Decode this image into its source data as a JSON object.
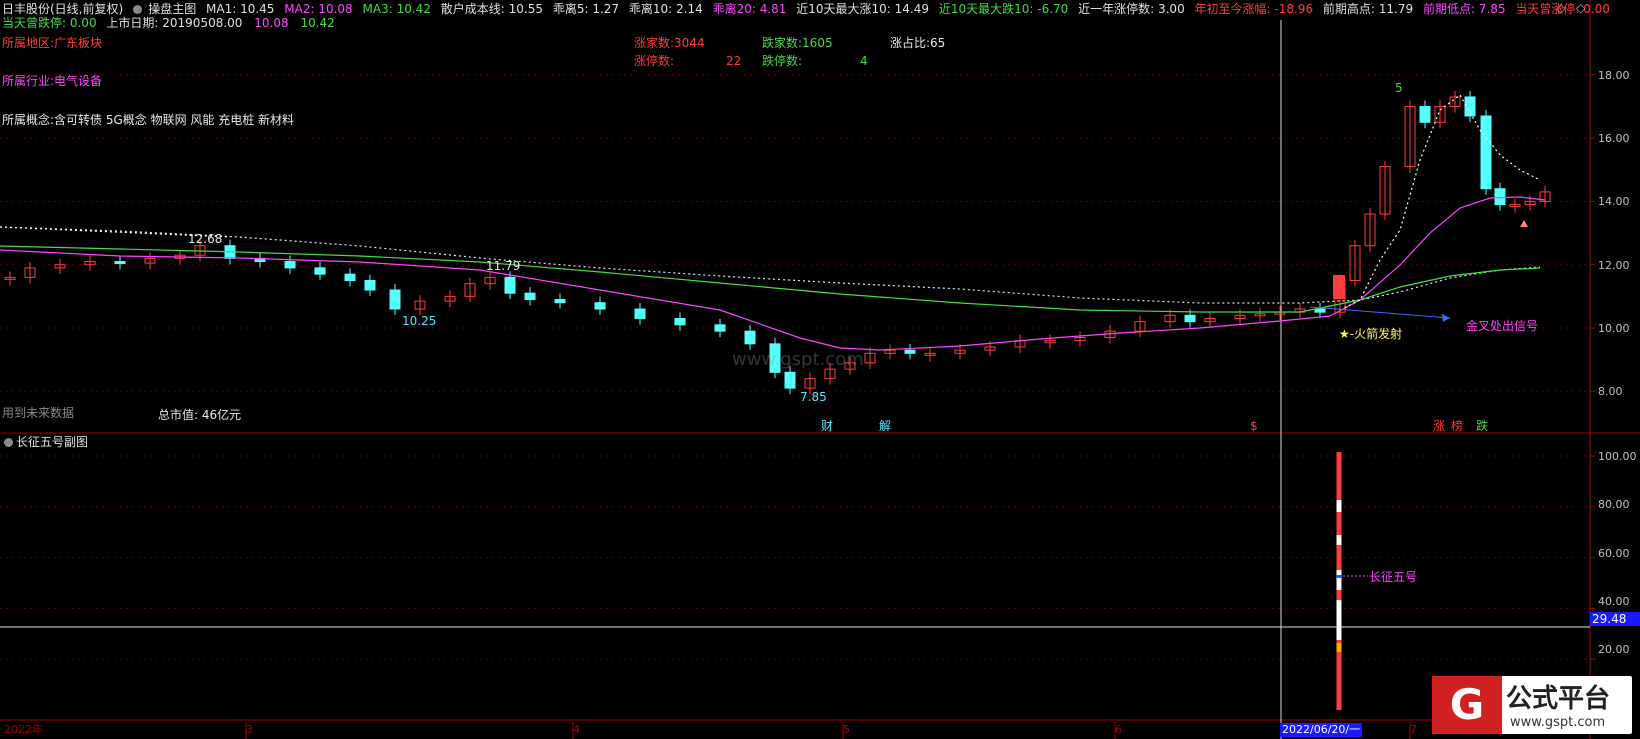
{
  "header": {
    "stock_name": "日丰股份(日线,前复权)",
    "main_chart_label": "操盘主图",
    "ma1": "MA1: 10.45",
    "ma2": "MA2: 10.08",
    "ma3": "MA3: 10.42",
    "retail_cost": "散户成本线: 10.55",
    "bias5": "乖离5: 1.27",
    "bias10": "乖离10: 2.14",
    "bias20": "乖离20: 4.81",
    "max_rise10": "近10天最大涨10: 14.49",
    "max_fall10": "近10天最大跌10: -6.70",
    "limit_up_year": "近一年涨停数: 3.00",
    "ytd_change": "年初至今涨幅: -18.96",
    "prev_high": "前期高点: 11.79",
    "prev_low": "前期低点: 7.85",
    "ever_limit_up": "当天曾涨停: 0.00",
    "ever_limit_down": "当天曾跌停: 0.00",
    "listing_date": "上市日期: 20190508.00",
    "val1": "10.08",
    "val2": "10.42"
  },
  "info": {
    "region": "所属地区:广东板块",
    "industry": "所属行业:电气设备",
    "concepts": "所属概念:含可转债 5G概念 物联网 风能 充电桩 新材料",
    "up_count": "涨家数:3044",
    "down_count": "跌家数:1605",
    "up_ratio": "涨占比:65",
    "limit_up_label": "涨停数:",
    "limit_up_value": "22",
    "limit_down_label": "跌停数:",
    "limit_down_value": "4",
    "future_data": "用到未来数据",
    "market_cap": "总市值: 46亿元"
  },
  "annotations": {
    "high_label": "12.68",
    "mid_label": "11.79",
    "low1_label": "10.25",
    "low2_label": "7.85",
    "rocket": "★-火箭发射",
    "golden_cross": "金叉处出信号",
    "count5": "5",
    "event_cai": "财",
    "event_jie": "解",
    "event_dollar": "$",
    "event_zhang": "涨",
    "event_bang": "榜",
    "event_die": "跌"
  },
  "sub_chart": {
    "title": "长征五号副图",
    "series_label": "长征五号",
    "cursor_value": "29.48"
  },
  "axis": {
    "main_ticks": [
      "18.00",
      "16.00",
      "14.00",
      "12.00",
      "10.00",
      "8.00"
    ],
    "sub_ticks": [
      "100.00",
      "80.00",
      "60.00",
      "40.00",
      "20.00"
    ],
    "time_labels": [
      "2022年",
      "3",
      "4",
      "5",
      "6",
      "7"
    ],
    "cursor_date": "2022/06/20/一"
  },
  "watermark": "www.gspt.com",
  "logo": {
    "title": "公式平台",
    "url": "www.gspt.com"
  },
  "colors": {
    "red": "#ff3c3c",
    "cyan": "#54ffff",
    "magenta": "#ff44ff",
    "green": "#44dd44",
    "yellow": "#ffff55",
    "axis_red": "#a00000"
  }
}
